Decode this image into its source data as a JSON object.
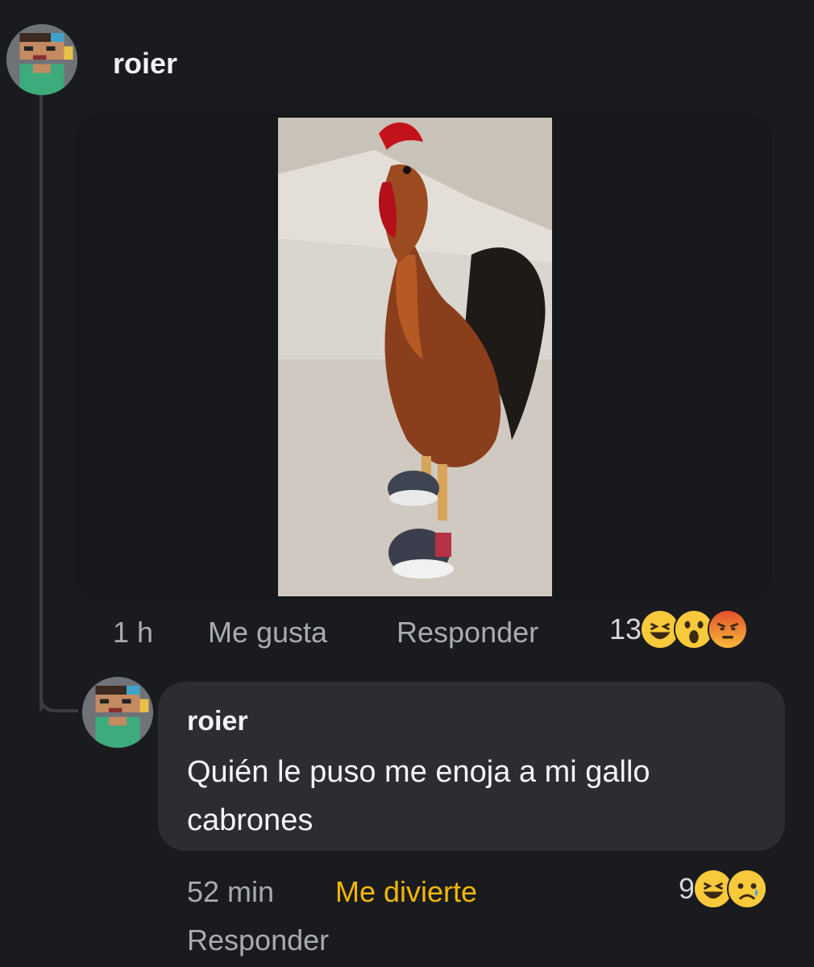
{
  "post": {
    "author": "roier",
    "avatar_icon": "pixel-avatar-icon",
    "media_description_icon": "rooster-image",
    "time": "1 h",
    "like_label": "Me gusta",
    "reply_label": "Responder",
    "reaction_count": "13",
    "reactions": [
      "haha-emoji",
      "wow-emoji",
      "angry-emoji"
    ]
  },
  "reply": {
    "author": "roier",
    "avatar_icon": "pixel-avatar-icon",
    "text": "Quién le puso me enoja a mi gallo cabrones",
    "time": "52 min",
    "reaction_label": "Me divierte",
    "reply_label": "Responder",
    "reaction_count": "9",
    "reactions": [
      "haha-emoji",
      "sad-emoji"
    ]
  },
  "colors": {
    "background": "#1a1b1f",
    "bubble": "#2b2d33",
    "muted_text": "#a9abb2",
    "accent_reaction": "#f2b705"
  }
}
